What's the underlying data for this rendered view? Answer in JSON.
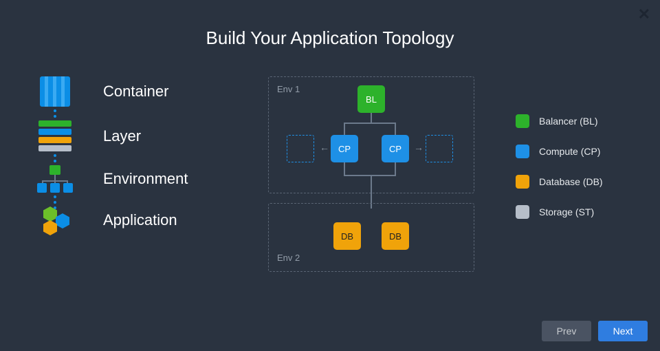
{
  "title": "Build Your Application Topology",
  "hierarchy": [
    {
      "label": "Container"
    },
    {
      "label": "Layer"
    },
    {
      "label": "Environment"
    },
    {
      "label": "Application"
    }
  ],
  "envs": {
    "env1": {
      "label": "Env 1"
    },
    "env2": {
      "label": "Env 2"
    }
  },
  "nodes": {
    "bl": "BL",
    "cp": "CP",
    "db": "DB"
  },
  "legend": [
    {
      "label": "Balancer (BL)",
      "color": "green"
    },
    {
      "label": "Compute (CP)",
      "color": "blue"
    },
    {
      "label": "Database (DB)",
      "color": "orange"
    },
    {
      "label": "Storage (ST)",
      "color": "grey"
    }
  ],
  "buttons": {
    "prev": "Prev",
    "next": "Next"
  }
}
